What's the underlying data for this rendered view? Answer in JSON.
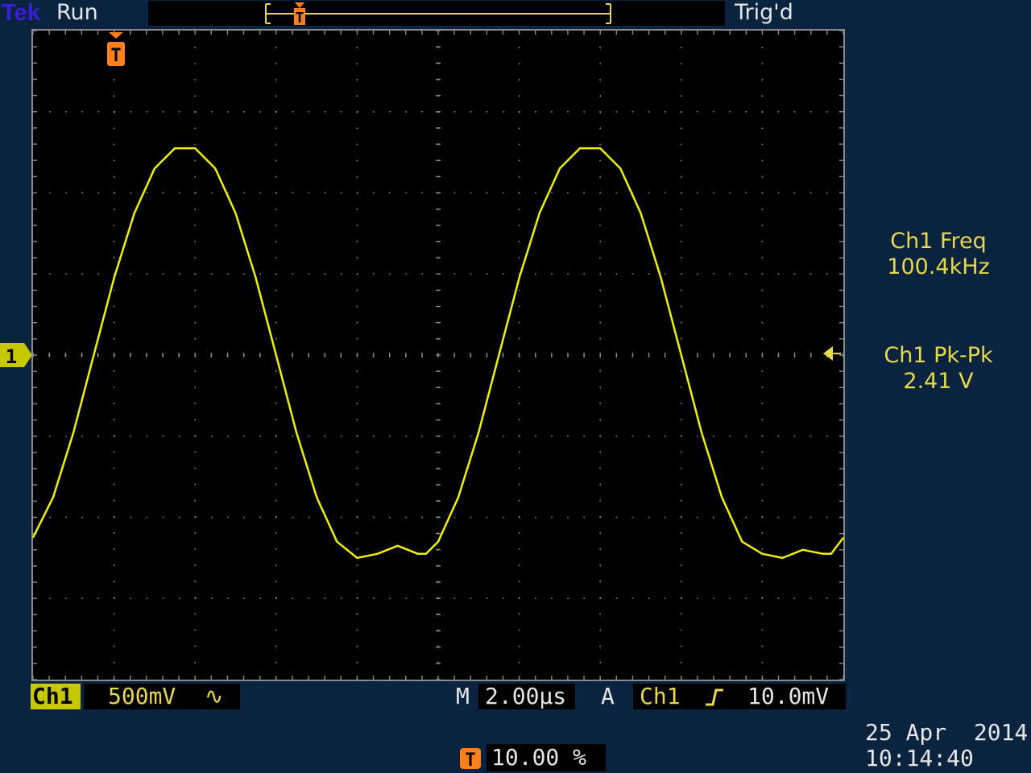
{
  "colors": {
    "background": "#0a2440",
    "ch1": "#f0f000",
    "ch1_text": "#e8d84a",
    "trigger": "#ff7f1a",
    "white_text": "#e6e6e6",
    "brand": "#3a1fd6",
    "grid": "#8a8a8a"
  },
  "header": {
    "brand": "Tek",
    "acquisition_state": "Run",
    "trigger_state": "Trig'd"
  },
  "markers": {
    "trigger_marker_label": "T",
    "ch1_ground_marker_label": "1"
  },
  "readouts": {
    "freq_label": "Ch1 Freq",
    "freq_value": "100.4kHz",
    "pkpk_label": "Ch1 Pk-Pk",
    "pkpk_value": "2.41 V"
  },
  "footer": {
    "ch1_label": "Ch1",
    "ch1_scale": "500mV",
    "ch1_bandwidth_icon": "∿",
    "timebase_prefix": "M",
    "timebase_value": "2.00µs",
    "trigger_mode": "A",
    "trigger_source": "Ch1",
    "trigger_slope_icon": "rising-edge-icon",
    "trigger_level": "10.0mV",
    "trigger_position_label": "T",
    "trigger_position_value": "10.00 %",
    "date": "25 Apr  2014",
    "time": "10:14:40"
  },
  "icons": {
    "ch1_ground": "channel-ground-marker-icon",
    "trigger": "trigger-marker-icon",
    "trigger_level": "trigger-level-arrow-icon",
    "slope": "rising-edge-icon",
    "bandwidth": "bandwidth-limit-icon"
  },
  "chart_data": {
    "type": "line",
    "grid": true,
    "divisions": {
      "x": 10,
      "y": 8
    },
    "series": [
      {
        "x_unit": "div",
        "y_unit": "div",
        "x": [
          0,
          0.25,
          0.5,
          0.75,
          1,
          1.25,
          1.5,
          1.75,
          2,
          2.25,
          2.5,
          2.75,
          3,
          3.25,
          3.5,
          3.75,
          4,
          4.25,
          4.5,
          4.75,
          4.85,
          5,
          5.25,
          5.5,
          5.75,
          6,
          6.25,
          6.5,
          6.75,
          7,
          7.25,
          7.25,
          7.5,
          7.75,
          8,
          8.25,
          8.5,
          8.75,
          9,
          9.25,
          9.5,
          9.75,
          9.85,
          10
        ],
        "y": [
          -2.25,
          -1.75,
          -0.95,
          0,
          0.95,
          1.75,
          2.3,
          2.55,
          2.55,
          2.3,
          1.75,
          0.95,
          0,
          -0.95,
          -1.75,
          -2.3,
          -2.5,
          -2.45,
          -2.35,
          -2.45,
          -2.45,
          -2.3,
          -1.75,
          -0.95,
          0,
          0.95,
          1.75,
          2.3,
          2.55,
          2.55,
          2.3,
          2.3,
          1.75,
          0.95,
          0,
          -0.95,
          -1.75,
          -2.3,
          -2.45,
          -2.5,
          -2.4,
          -2.45,
          -2.45,
          -2.25
        ]
      }
    ]
  }
}
